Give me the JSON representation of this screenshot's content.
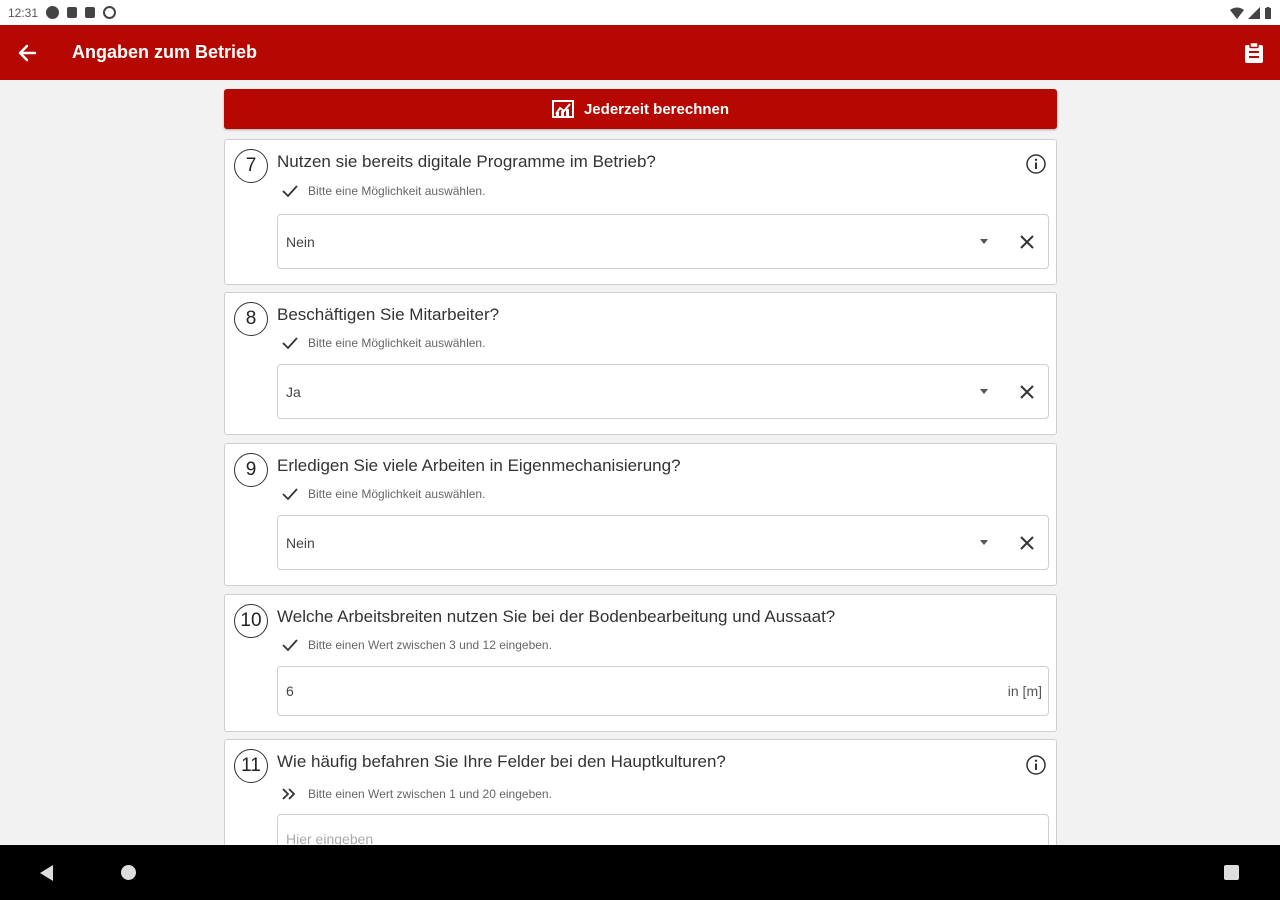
{
  "status_bar": {
    "time": "12:31"
  },
  "app_bar": {
    "title": "Angaben zum Betrieb"
  },
  "calc_button": {
    "label": "Jederzeit berechnen"
  },
  "questions": [
    {
      "number": "7",
      "text": "Nutzen sie bereits digitale Programme im Betrieb?",
      "hint": "Bitte eine Möglichkeit auswählen.",
      "value": "Nein",
      "hint_icon": "check-icon",
      "has_info": true
    },
    {
      "number": "8",
      "text": "Beschäftigen Sie Mitarbeiter?",
      "hint": "Bitte eine Möglichkeit auswählen.",
      "value": "Ja",
      "hint_icon": "check-icon",
      "has_info": false
    },
    {
      "number": "9",
      "text": "Erledigen Sie viele Arbeiten in Eigenmechanisierung?",
      "hint": "Bitte eine Möglichkeit auswählen.",
      "value": "Nein",
      "hint_icon": "check-icon",
      "has_info": false
    },
    {
      "number": "10",
      "text": "Welche Arbeitsbreiten nutzen Sie bei der Bodenbearbeitung und Aussaat?",
      "hint": "Bitte einen Wert zwischen 3 und 12 eingeben.",
      "value": "6",
      "unit": "in [m]",
      "hint_icon": "check-icon",
      "has_info": false
    },
    {
      "number": "11",
      "text": "Wie häufig befahren Sie Ihre Felder bei den Hauptkulturen?",
      "hint": "Bitte einen Wert zwischen 1 und 20 eingeben.",
      "placeholder": "Hier eingeben",
      "hint_icon": "double-chevron-right-icon",
      "has_info": true
    }
  ],
  "colors": {
    "primary": "#b50800",
    "background": "#f2f2f2",
    "card": "#ffffff"
  }
}
